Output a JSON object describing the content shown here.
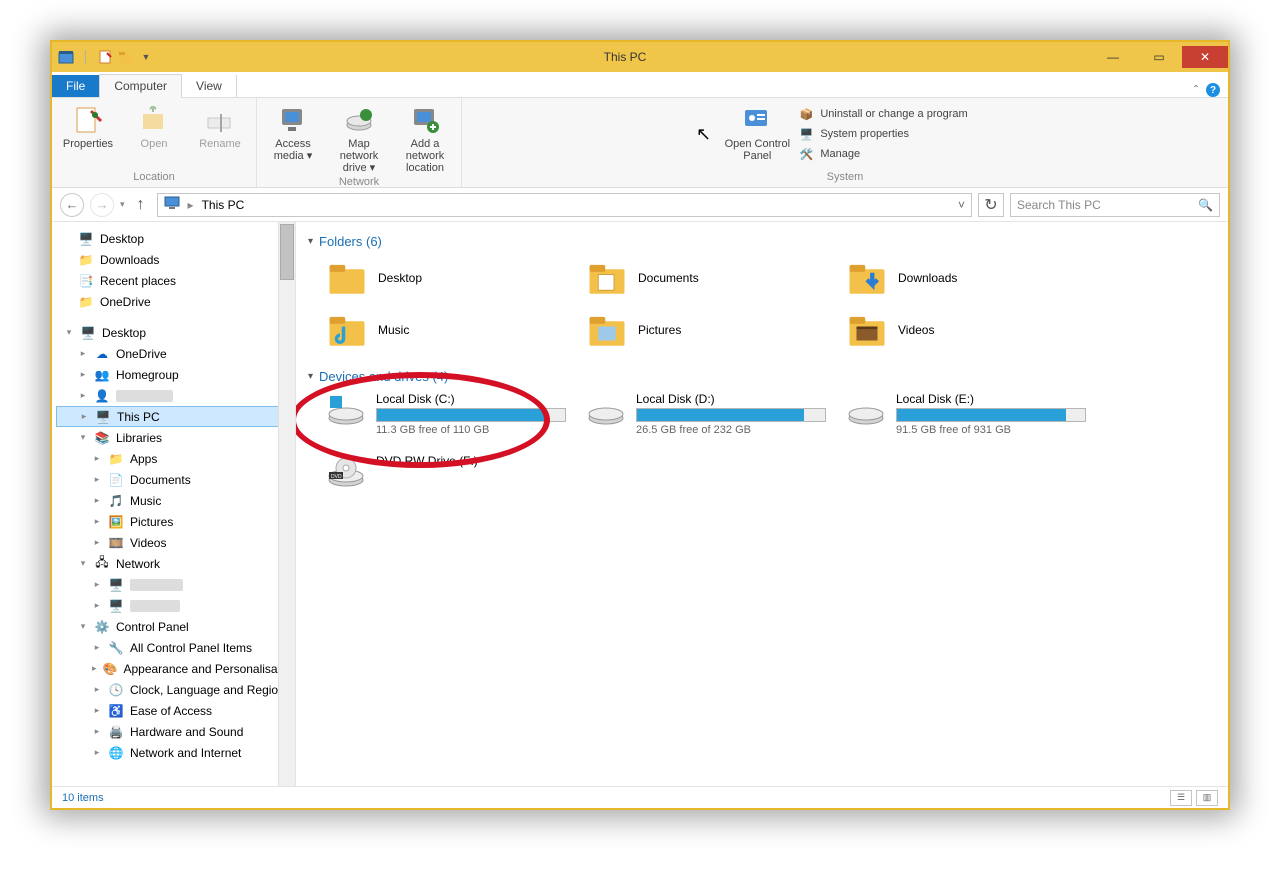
{
  "window": {
    "title": "This PC"
  },
  "tabs": {
    "file": "File",
    "computer": "Computer",
    "view": "View"
  },
  "ribbon": {
    "location": {
      "label": "Location",
      "properties": "Properties",
      "open": "Open",
      "rename": "Rename"
    },
    "network": {
      "label": "Network",
      "access": "Access media ▾",
      "map": "Map network drive ▾",
      "add": "Add a network location"
    },
    "system": {
      "label": "System",
      "cp": "Open Control Panel",
      "uninstall": "Uninstall or change a program",
      "sysprop": "System properties",
      "manage": "Manage"
    }
  },
  "address": {
    "path": "This PC",
    "search_placeholder": "Search This PC"
  },
  "sidebar": {
    "fav": {
      "desktop": "Desktop",
      "downloads": "Downloads",
      "recent": "Recent places",
      "onedrive": "OneDrive"
    },
    "desk": {
      "desktop": "Desktop",
      "onedrive": "OneDrive",
      "homegroup": "Homegroup",
      "user": "",
      "thispc": "This PC",
      "libraries": "Libraries",
      "apps": "Apps",
      "documents": "Documents",
      "music": "Music",
      "pictures": "Pictures",
      "videos": "Videos",
      "network": "Network",
      "net1": "",
      "net2": "",
      "cp": "Control Panel",
      "cp1": "All Control Panel Items",
      "cp2": "Appearance and Personalisation",
      "cp3": "Clock, Language and Region",
      "cp4": "Ease of Access",
      "cp5": "Hardware and Sound",
      "cp6": "Network and Internet"
    }
  },
  "sections": {
    "folders": "Folders (6)",
    "drives": "Devices and drives (4)"
  },
  "folders": {
    "desktop": "Desktop",
    "documents": "Documents",
    "downloads": "Downloads",
    "music": "Music",
    "pictures": "Pictures",
    "videos": "Videos"
  },
  "drives": {
    "c": {
      "label": "Local Disk (C:)",
      "free": "11.3 GB free of 110 GB",
      "pct": 90
    },
    "d": {
      "label": "Local Disk (D:)",
      "free": "26.5 GB free of 232 GB",
      "pct": 89
    },
    "e": {
      "label": "Local Disk (E:)",
      "free": "91.5 GB free of 931 GB",
      "pct": 90
    },
    "f": {
      "label": "DVD RW Drive (F:)"
    }
  },
  "status": {
    "items": "10 items"
  }
}
